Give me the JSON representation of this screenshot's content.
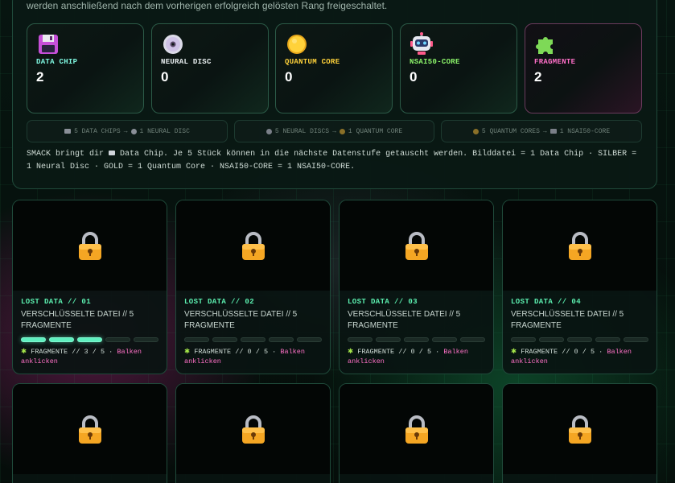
{
  "intro_text": "werden anschließend nach dem vorherigen erfolgreich gelösten Rang freigeschaltet.",
  "resources": [
    {
      "key": "data-chip",
      "name": "DATA CHIP",
      "count": "2",
      "color": "#7ff7e0",
      "icon": "floppy-disk-icon"
    },
    {
      "key": "neural-disc",
      "name": "NEURAL DISC",
      "count": "0",
      "color": "#e8eef0",
      "icon": "optical-disc-icon"
    },
    {
      "key": "quantum-core",
      "name": "QUANTUM CORE",
      "count": "0",
      "color": "#ffd23a",
      "icon": "gold-coin-icon"
    },
    {
      "key": "nsai50-core",
      "name": "NSAI50-CORE",
      "count": "0",
      "color": "#8cf56a",
      "icon": "robot-icon"
    },
    {
      "key": "fragmente",
      "name": "FRAGMENTE",
      "count": "2",
      "color": "#ff6fc8",
      "icon": "puzzle-piece-icon"
    }
  ],
  "exchanges": [
    {
      "from": "5 DATA CHIPS",
      "to": "1 NEURAL DISC"
    },
    {
      "from": "5 NEURAL DISCS",
      "to": "1 QUANTUM CORE"
    },
    {
      "from": "5 QUANTUM CORES",
      "to": "1 NSAI50-CORE"
    }
  ],
  "arrow": "→",
  "note": {
    "before": "SMACK bringt dir",
    "after": "Data Chip. Je 5 Stück können in die nächste Datenstufe getauscht werden. Bilddatei = 1 Data Chip · SILBER = 1 Neural Disc · GOLD = 1 Quantum Core · NSAI50-CORE = 1 NSAI50-CORE."
  },
  "tiles": [
    {
      "label": "LOST DATA // 01",
      "title": "VERSCHLÜSSELTE DATEI // 5 FRAGMENTE",
      "progress": 3,
      "total": 5,
      "frag_text": "FRAGMENTE // 3 / 5 ·",
      "cta": "Balken anklicken"
    },
    {
      "label": "LOST DATA // 02",
      "title": "VERSCHLÜSSELTE DATEI // 5 FRAGMENTE",
      "progress": 0,
      "total": 5,
      "frag_text": "FRAGMENTE // 0 / 5 ·",
      "cta": "Balken anklicken"
    },
    {
      "label": "LOST DATA // 03",
      "title": "VERSCHLÜSSELTE DATEI // 5 FRAGMENTE",
      "progress": 0,
      "total": 5,
      "frag_text": "FRAGMENTE // 0 / 5 ·",
      "cta": "Balken anklicken"
    },
    {
      "label": "LOST DATA // 04",
      "title": "VERSCHLÜSSELTE DATEI // 5 FRAGMENTE",
      "progress": 0,
      "total": 5,
      "frag_text": "FRAGMENTE // 0 / 5 ·",
      "cta": "Balken anklicken"
    }
  ],
  "lower_tiles_count": 4
}
